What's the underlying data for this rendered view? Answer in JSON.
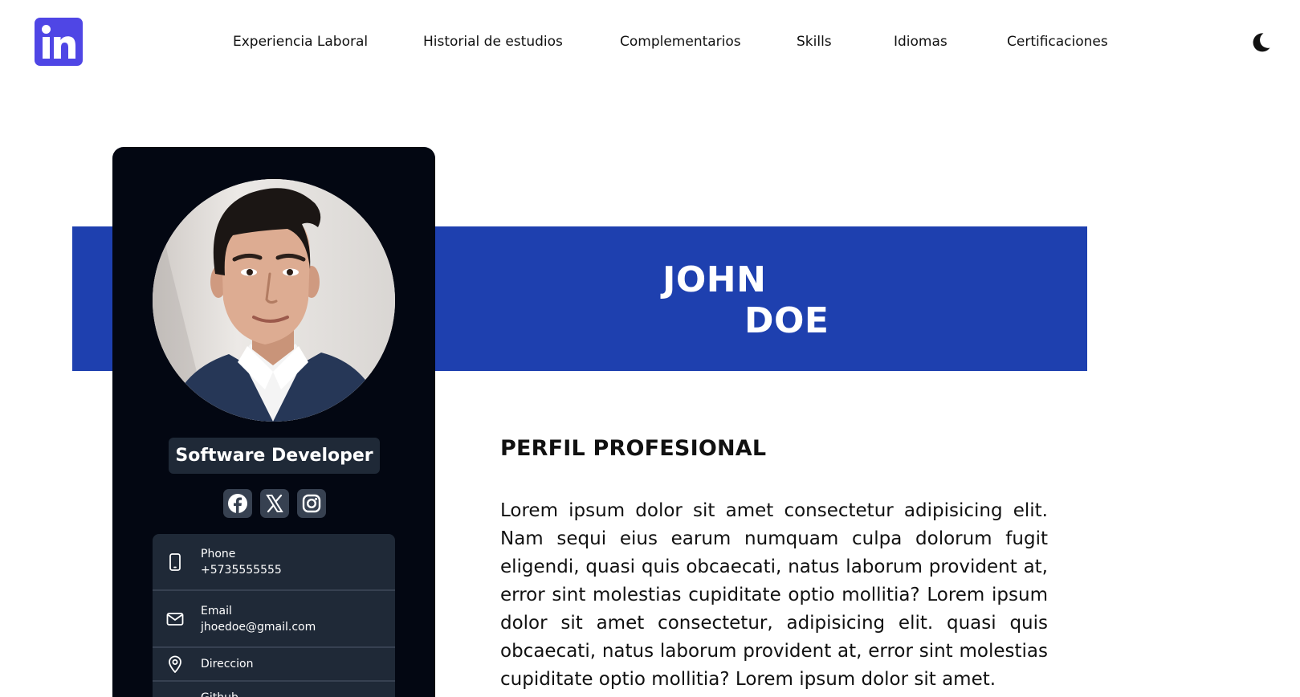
{
  "header": {
    "logo_icon": "linkedin-icon",
    "nav": [
      {
        "label": "Experiencia Laboral"
      },
      {
        "label": "Historial de estudios"
      },
      {
        "label": "Complementarios"
      },
      {
        "label": "Skills"
      },
      {
        "label": "Idiomas"
      },
      {
        "label": "Certificaciones"
      }
    ],
    "theme_toggle_icon": "moon-icon"
  },
  "banner": {
    "first_name": "JOHN",
    "last_name": "DOE",
    "color": "#1e40af"
  },
  "card": {
    "background": "#030712",
    "role": "Software Developer",
    "socials": [
      {
        "icon": "facebook-icon"
      },
      {
        "icon": "x-twitter-icon"
      },
      {
        "icon": "instagram-icon"
      }
    ],
    "contacts": [
      {
        "icon": "phone-icon",
        "label": "Phone",
        "value": "+5735555555"
      },
      {
        "icon": "mail-icon",
        "label": "Email",
        "value": "jhoedoe@gmail.com"
      },
      {
        "icon": "location-pin-icon",
        "label": "Direccion"
      },
      {
        "icon": "github-icon",
        "label": "Github"
      }
    ]
  },
  "profile": {
    "title": "PERFIL PROFESIONAL",
    "body": "Lorem ipsum dolor sit amet consectetur adipisicing elit. Nam sequi eius earum numquam culpa dolorum fugit eligendi, quasi quis obcaecati, natus laborum provident at, error sint molestias cupiditate optio mollitia? Lorem ipsum dolor sit amet consectetur, adipisicing elit. quasi quis obcaecati, natus laborum provident at, error sint molestias cupiditate optio mollitia? Lorem ipsum dolor sit amet."
  }
}
